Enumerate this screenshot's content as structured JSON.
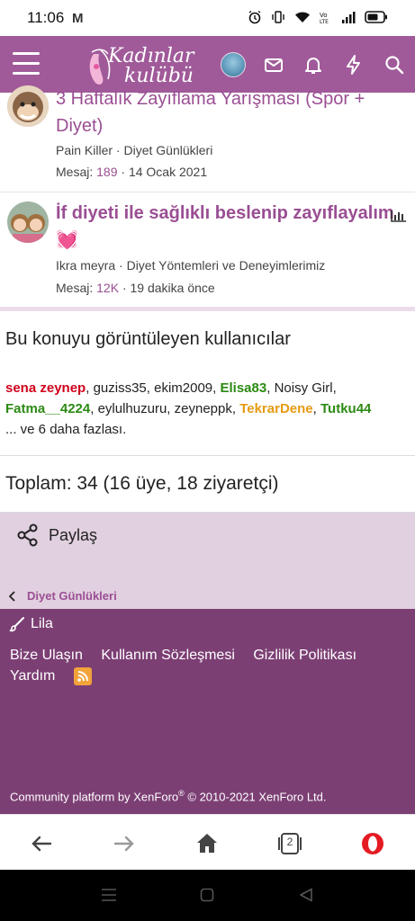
{
  "status": {
    "time": "11:06",
    "app_icon": "M",
    "icons": [
      "alarm-icon",
      "vibrate-icon",
      "wifi-icon",
      "volte-icon",
      "signal-icon",
      "battery-icon"
    ]
  },
  "header": {
    "logo_line1": "Kadınlar",
    "logo_line2": "kulübü",
    "icons": [
      "menu-icon",
      "avatar",
      "mail-icon",
      "bell-icon",
      "bolt-icon",
      "search-icon"
    ],
    "bg_color": "#a05a99"
  },
  "threads": [
    {
      "title": "3 Haftalık Zayıflama Yarışması (Spor + Diyet)",
      "author": "Pain Killer",
      "forum": "Diyet Günlükleri",
      "replies_label": "Mesaj:",
      "replies": "189",
      "date": "14 Ocak 2021"
    },
    {
      "title": "İf diyeti ile sağlıklı beslenip zayıflayalım 💓",
      "author": "Ikra meyra",
      "forum": "Diyet Yöntemleri ve Deneyimlerimiz",
      "replies_label": "Mesaj:",
      "replies": "12K",
      "date": "19 dakika önce"
    }
  ],
  "viewers": {
    "heading": "Bu konuyu görüntüleyen kullanıcılar",
    "users": [
      {
        "name": "sena zeynep",
        "style": "red"
      },
      {
        "name": "guziss35",
        "style": "plain"
      },
      {
        "name": "ekim2009",
        "style": "plain"
      },
      {
        "name": "Elisa83",
        "style": "green"
      },
      {
        "name": "Noisy Girl",
        "style": "plain"
      },
      {
        "name": "Fatma__4224",
        "style": "green"
      },
      {
        "name": "eylulhuzuru",
        "style": "plain"
      },
      {
        "name": "zeyneppk",
        "style": "plain"
      },
      {
        "name": "TekrarDene",
        "style": "orange"
      },
      {
        "name": "Tutku44",
        "style": "green"
      }
    ],
    "more": "... ve 6 daha fazlası."
  },
  "total": "Toplam: 34 (16 üye, 18 ziyaretçi)",
  "share": {
    "label": "Paylaş"
  },
  "breadcrumb": {
    "label": "Diyet Günlükleri"
  },
  "footer": {
    "style_label": "Lila",
    "links": [
      "Bize Ulaşın",
      "Kullanım Sözleşmesi",
      "Gizlilik Politikası",
      "Yardım"
    ],
    "copyright_prefix": "Community platform by XenForo",
    "copyright_reg": "®",
    "copyright_suffix": " © 2010-2021 XenForo Ltd.",
    "bg_color": "#7c3f74"
  },
  "browser": {
    "tabs_count": "2"
  }
}
